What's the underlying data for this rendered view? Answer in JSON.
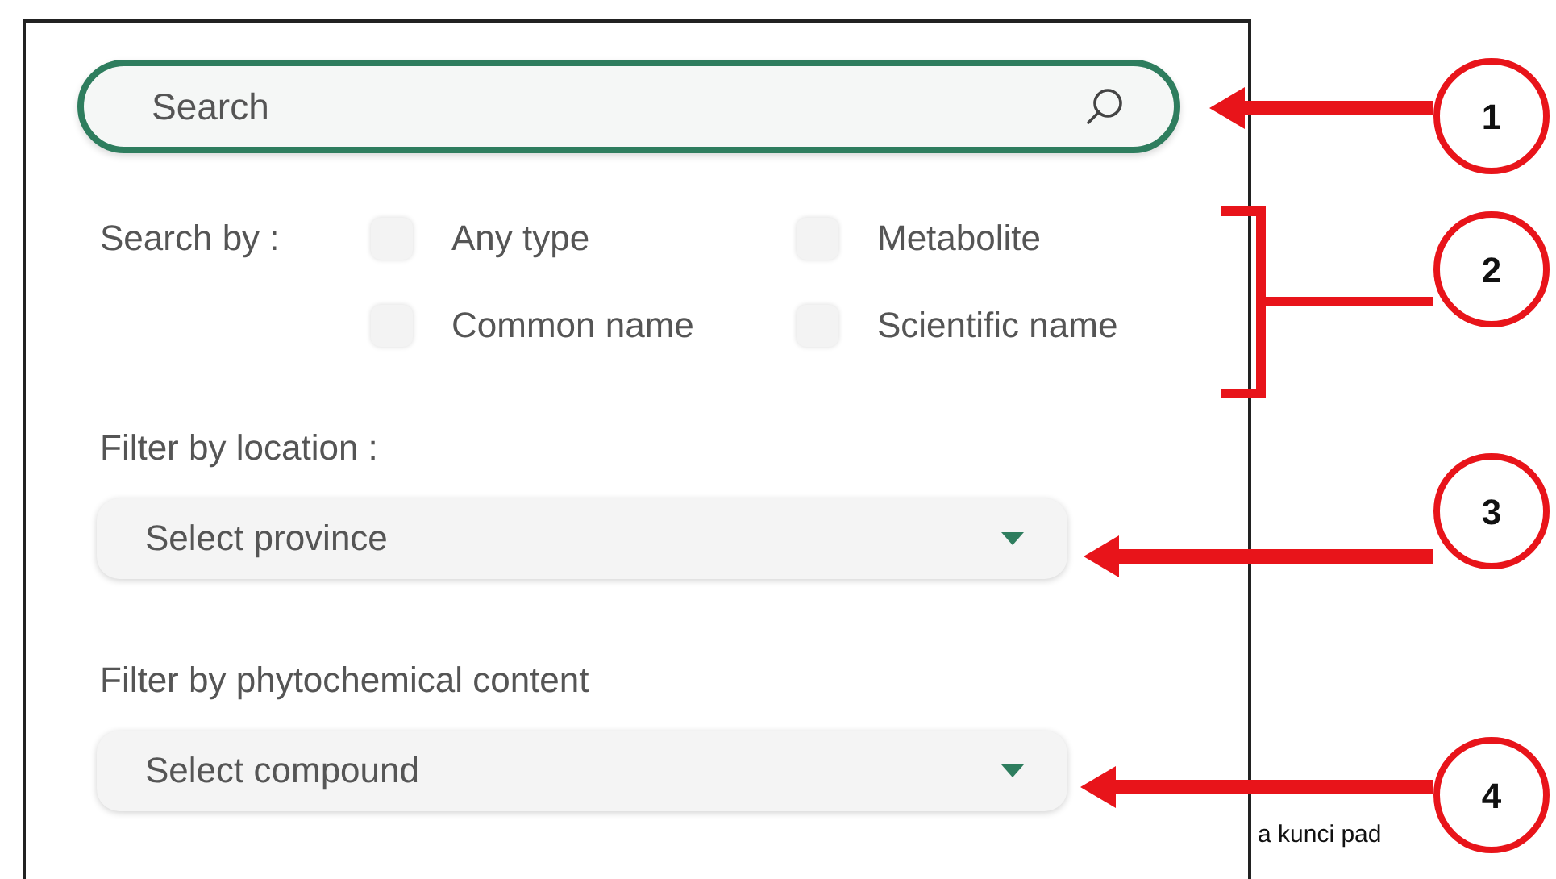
{
  "search": {
    "placeholder": "Search"
  },
  "search_by": {
    "label": "Search by :",
    "options": [
      {
        "label": "Any type",
        "checked": false
      },
      {
        "label": "Metabolite",
        "checked": false
      },
      {
        "label": "Common name",
        "checked": false
      },
      {
        "label": "Scientific name",
        "checked": false
      }
    ]
  },
  "filters": [
    {
      "label": "Filter by location :",
      "placeholder": "Select province"
    },
    {
      "label": "Filter by phytochemical content",
      "placeholder": "Select compound"
    }
  ],
  "background_text": "a kunci pad",
  "callouts": [
    {
      "number": "1",
      "kind": "arrow"
    },
    {
      "number": "2",
      "kind": "bracket"
    },
    {
      "number": "3",
      "kind": "arrow"
    },
    {
      "number": "4",
      "kind": "arrow"
    }
  ]
}
